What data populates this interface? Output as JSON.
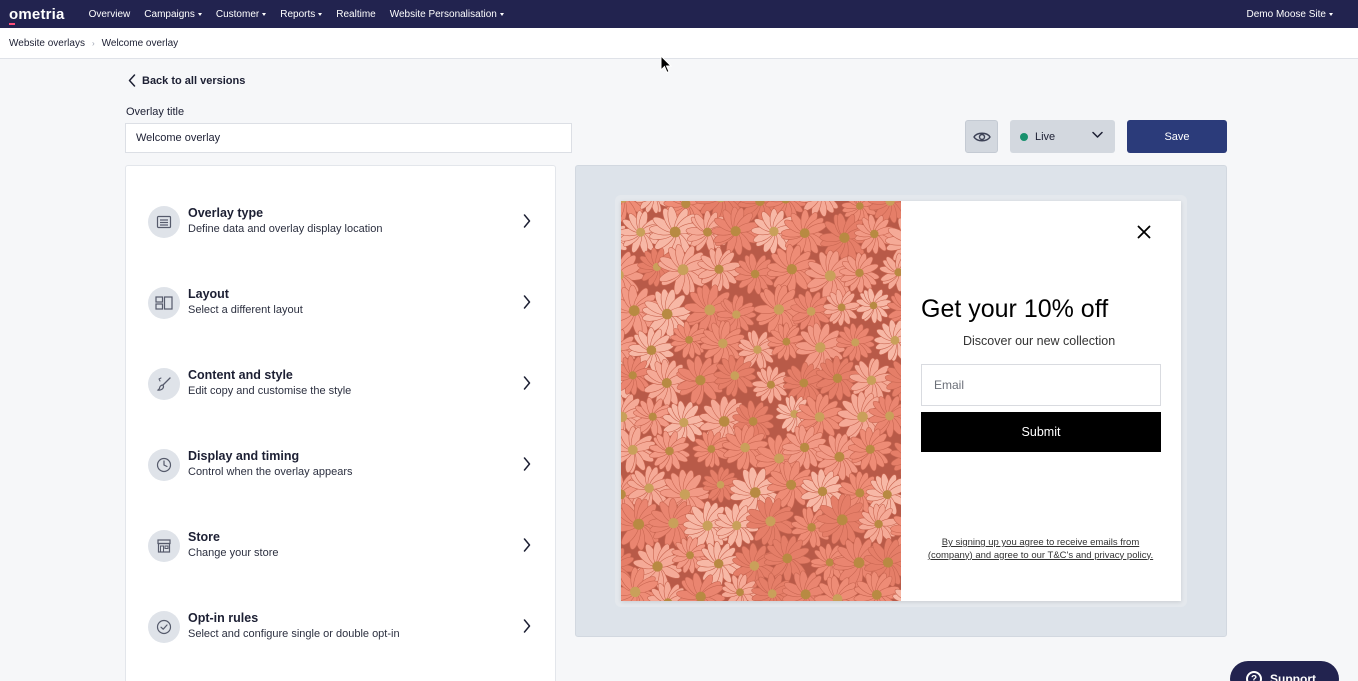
{
  "nav": {
    "logo": "ometria",
    "items": [
      {
        "label": "Overview",
        "dropdown": false
      },
      {
        "label": "Campaigns",
        "dropdown": true
      },
      {
        "label": "Customer",
        "dropdown": true
      },
      {
        "label": "Reports",
        "dropdown": true
      },
      {
        "label": "Realtime",
        "dropdown": false
      },
      {
        "label": "Website Personalisation",
        "dropdown": true
      }
    ],
    "site": "Demo Moose Site"
  },
  "breadcrumb": {
    "parent": "Website overlays",
    "current": "Welcome overlay"
  },
  "back_label": "Back to all versions",
  "overlay_title": {
    "label": "Overlay title",
    "value": "Welcome overlay"
  },
  "toolbar": {
    "status": "Live",
    "status_color": "#18906d",
    "save_label": "Save"
  },
  "settings": [
    {
      "title": "Overlay type",
      "desc": "Define data and overlay display location",
      "icon": "overlay-type-icon"
    },
    {
      "title": "Layout",
      "desc": "Select a different layout",
      "icon": "layout-icon"
    },
    {
      "title": "Content and style",
      "desc": "Edit copy and customise the style",
      "icon": "brush-icon"
    },
    {
      "title": "Display and timing",
      "desc": "Control when the overlay appears",
      "icon": "clock-icon"
    },
    {
      "title": "Store",
      "desc": "Change your store",
      "icon": "store-icon"
    },
    {
      "title": "Opt-in rules",
      "desc": "Select and configure single or double opt-in",
      "icon": "check-circle-icon"
    }
  ],
  "preview": {
    "heading": "Get your 10% off",
    "subheading": "Discover our new collection",
    "email_placeholder": "Email",
    "submit_label": "Submit",
    "legal": "By signing up you agree to receive emails from (company) and agree to our T&C's and privacy policy."
  },
  "support_label": "Support",
  "colors": {
    "nav_bg": "#22234f",
    "primary_button": "#2b3b7a"
  }
}
